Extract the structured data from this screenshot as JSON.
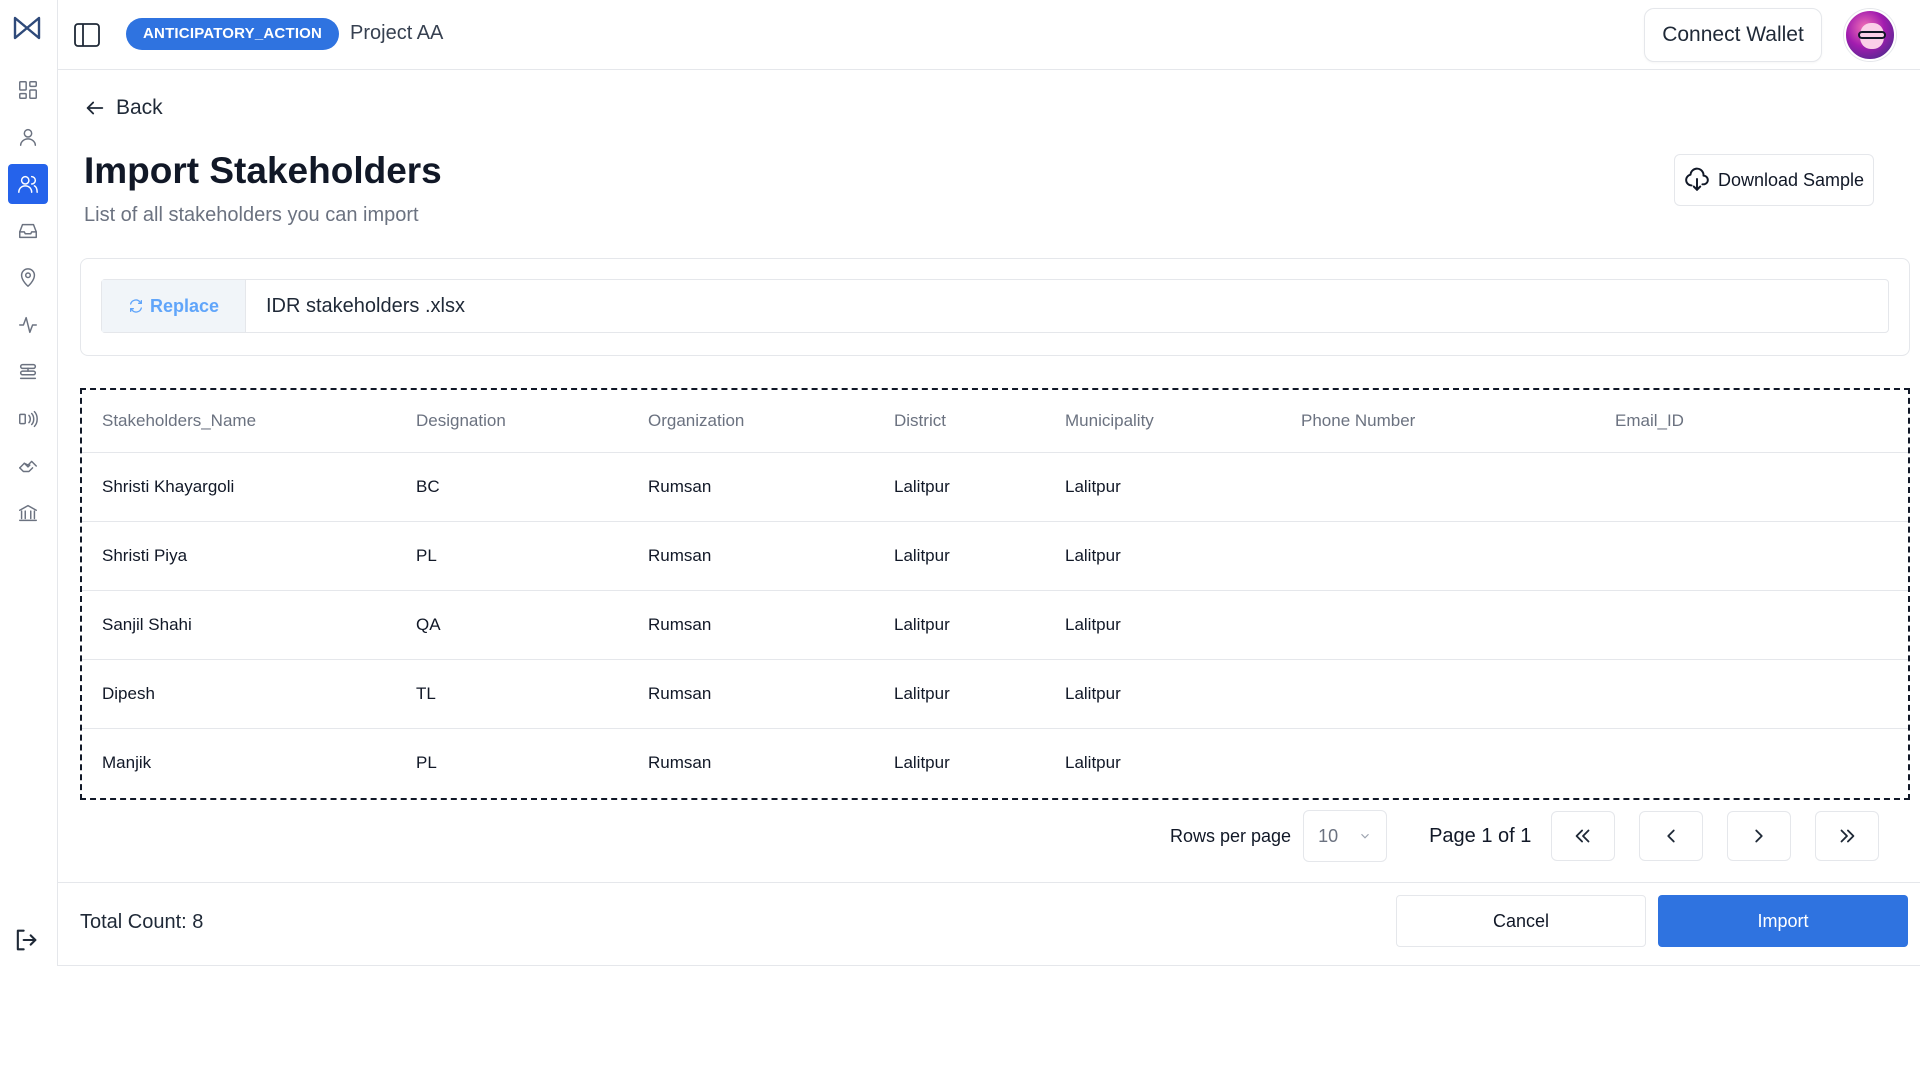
{
  "header": {
    "project_badge": "ANTICIPATORY_ACTION",
    "project_name": "Project AA",
    "connect_wallet_label": "Connect Wallet"
  },
  "sidebar": {
    "items": [
      {
        "icon": "dashboard-icon",
        "active": false
      },
      {
        "icon": "user-icon",
        "active": false
      },
      {
        "icon": "users-icon",
        "active": true
      },
      {
        "icon": "inbox-icon",
        "active": false
      },
      {
        "icon": "location-icon",
        "active": false
      },
      {
        "icon": "activity-icon",
        "active": false
      },
      {
        "icon": "stack-icon",
        "active": false
      },
      {
        "icon": "broadcast-icon",
        "active": false
      },
      {
        "icon": "handshake-icon",
        "active": false
      },
      {
        "icon": "bank-icon",
        "active": false
      }
    ],
    "logout_icon": "logout-icon"
  },
  "page": {
    "back_label": "Back",
    "title": "Import Stakeholders",
    "subtitle": "List of all stakeholders you can import",
    "download_sample_label": "Download Sample"
  },
  "file": {
    "replace_label": "Replace",
    "file_name": "IDR stakeholders .xlsx"
  },
  "table": {
    "columns": [
      "Stakeholders_Name",
      "Designation",
      "Organization",
      "District",
      "Municipality",
      "Phone Number",
      "Email_ID"
    ],
    "rows": [
      [
        "Shristi Khayargoli",
        "BC",
        "Rumsan",
        "Lalitpur",
        "Lalitpur",
        "",
        ""
      ],
      [
        "Shristi Piya",
        "PL",
        "Rumsan",
        "Lalitpur",
        "Lalitpur",
        "",
        ""
      ],
      [
        "Sanjil Shahi",
        "QA",
        "Rumsan",
        "Lalitpur",
        "Lalitpur",
        "",
        ""
      ],
      [
        "Dipesh",
        "TL",
        "Rumsan",
        "Lalitpur",
        "Lalitpur",
        "",
        ""
      ],
      [
        "Manjik",
        "PL",
        "Rumsan",
        "Lalitpur",
        "Lalitpur",
        "",
        ""
      ]
    ]
  },
  "pagination": {
    "rows_per_page_label": "Rows per page",
    "rows_per_page_value": "10",
    "page_info": "Page 1 of 1"
  },
  "footer": {
    "total_count": "Total Count: 8",
    "cancel_label": "Cancel",
    "import_label": "Import"
  },
  "colors": {
    "accent": "#2f73e0",
    "replace_text": "#60a5fa"
  }
}
